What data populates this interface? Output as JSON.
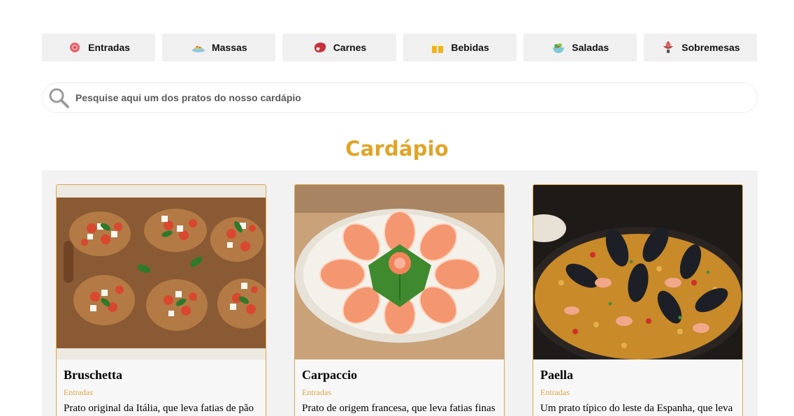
{
  "categories": [
    {
      "label": "Entradas",
      "icon": "appetizer-icon"
    },
    {
      "label": "Massas",
      "icon": "pasta-icon"
    },
    {
      "label": "Carnes",
      "icon": "meat-icon"
    },
    {
      "label": "Bebidas",
      "icon": "drinks-icon"
    },
    {
      "label": "Saladas",
      "icon": "salad-icon"
    },
    {
      "label": "Sobremesas",
      "icon": "dessert-icon"
    }
  ],
  "search": {
    "placeholder": "Pesquise aqui um dos pratos do nosso cardápio",
    "value": ""
  },
  "menu": {
    "title": "Cardápio",
    "dishes": [
      {
        "name": "Bruschetta",
        "category": "Entradas",
        "description": "Prato original da Itália, que leva fatias de pão italiano tostadas com azeite de oliva",
        "image": "bruschetta-photo"
      },
      {
        "name": "Carpaccio",
        "category": "Entradas",
        "description": "Prato de origem francesa, que leva fatias finas de salmão cru dispostas em círculo",
        "image": "carpaccio-photo"
      },
      {
        "name": "Paella",
        "category": "Entradas",
        "description": "Um prato típico do leste da Espanha, que leva arroz, frutos do mar e açafrão",
        "image": "paella-photo"
      }
    ]
  },
  "colors": {
    "accent": "#e0a428",
    "card_border": "#dca64a",
    "button_bg": "#f0f0f0",
    "panel_bg": "#f2f2f2"
  }
}
